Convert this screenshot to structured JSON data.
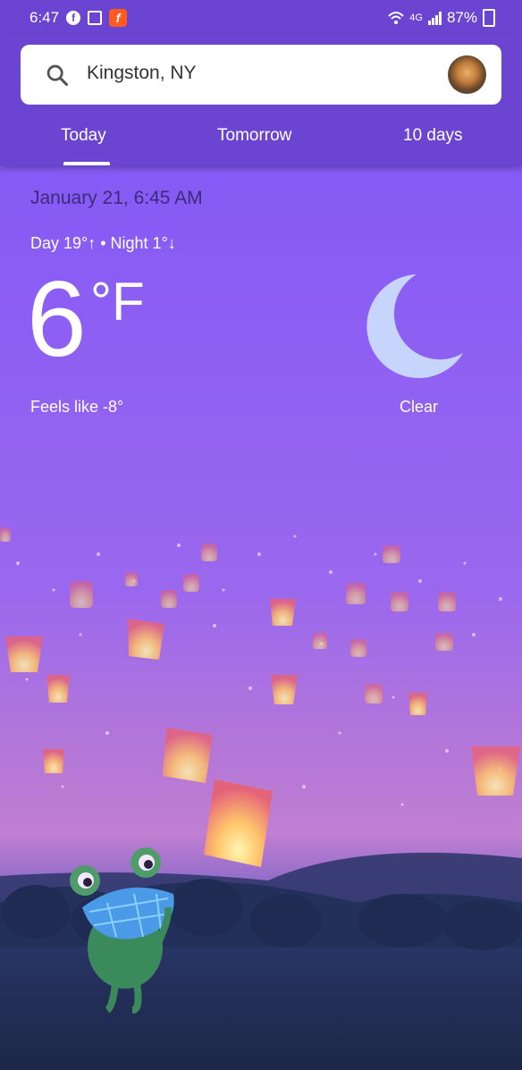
{
  "status_bar": {
    "time": "6:47",
    "network": "4G",
    "battery": "87%",
    "icons": [
      "facebook-icon",
      "calendar-icon",
      "app-f-icon",
      "wifi-icon",
      "signal-icon",
      "battery-icon"
    ]
  },
  "search": {
    "location": "Kingston, NY"
  },
  "tabs": [
    {
      "label": "Today",
      "selected": true
    },
    {
      "label": "Tomorrow",
      "selected": false
    },
    {
      "label": "10 days",
      "selected": false
    }
  ],
  "weather": {
    "date": "January 21, 6:45 AM",
    "day_night": "Day 19°↑ • Night 1°↓",
    "temperature": "6",
    "unit": "°F",
    "feels_like": "Feels like -8°",
    "condition": "Clear",
    "condition_icon": "moon-icon"
  },
  "colors": {
    "header": "#6b45d2",
    "accent": "#ffffff",
    "sky_top": "#7d57f6"
  }
}
